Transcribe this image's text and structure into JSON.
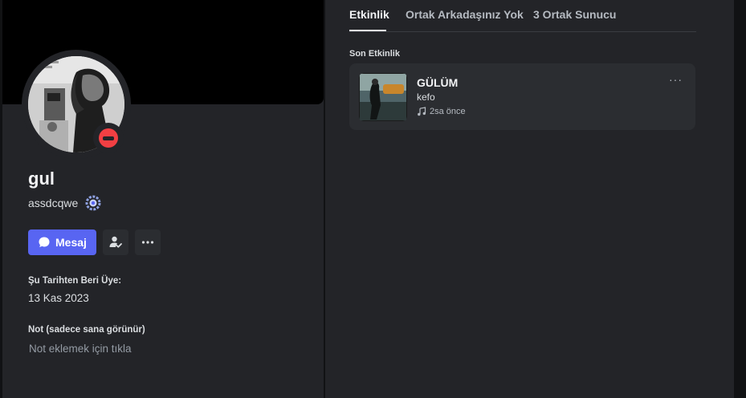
{
  "profile": {
    "display_name": "gul",
    "username": "assdcqwe",
    "status": "dnd",
    "message_button": "Mesaj",
    "member_since_label": "Şu Tarihten Beri Üye:",
    "member_since_value": "13 Kas 2023",
    "note_label": "Not (sadece sana görünür)",
    "note_placeholder": "Not eklemek için tıkla"
  },
  "tabs": [
    {
      "label": "Etkinlik",
      "active": true
    },
    {
      "label": "Ortak Arkadaşınız Yok",
      "active": false
    },
    {
      "label": "3 Ortak Sunucu",
      "active": false
    }
  ],
  "activity": {
    "heading": "Son Etkinlik",
    "song": "GÜLÜM",
    "artist": "kefo",
    "time": "2sa önce",
    "more_label": "···"
  },
  "icons": {
    "message": "chat-bubble-icon",
    "friend_action": "user-check-icon",
    "more": "more-horizontal-icon",
    "badge": "nitro-badge-icon",
    "music": "music-note-icon"
  },
  "colors": {
    "accent": "#5865f2",
    "dnd": "#f23f43",
    "panel": "#232428",
    "background": "#111214"
  }
}
